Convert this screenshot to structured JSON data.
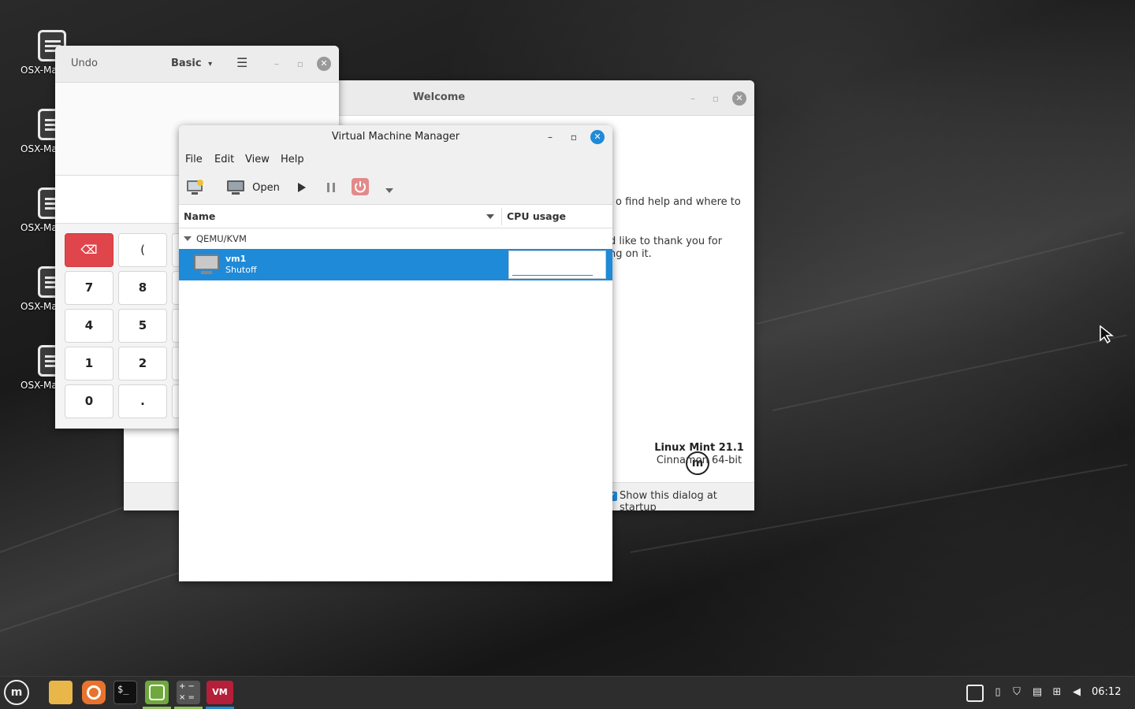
{
  "desktop": {
    "icons": [
      {
        "label": "OSX-Ma"
      },
      {
        "label": "OSX-Ma"
      },
      {
        "label": "OSX-Ma"
      },
      {
        "label": "OSX-Ma"
      },
      {
        "label": "OSX-Ma"
      }
    ]
  },
  "welcome": {
    "title": "Welcome",
    "text_line1": "o find help and where to",
    "text_line2": "d like to thank you for",
    "text_line3": "ng on it.",
    "product_name": "Linux Mint 21.1",
    "product_edition": "Cinnamon 64-bit",
    "startup_checkbox_label": "Show this dialog at startup",
    "startup_checkbox_checked": true
  },
  "calculator": {
    "undo_label": "Undo",
    "mode_label": "Basic",
    "keys": {
      "backspace": "⌫",
      "open_paren": "(",
      "seven": "7",
      "eight": "8",
      "four": "4",
      "five": "5",
      "one": "1",
      "two": "2",
      "zero": "0",
      "point": "."
    }
  },
  "vmm": {
    "title": "Virtual Machine Manager",
    "menu": {
      "file": "File",
      "edit": "Edit",
      "view": "View",
      "help": "Help"
    },
    "toolbar": {
      "open_label": "Open"
    },
    "columns": {
      "name": "Name",
      "cpu": "CPU usage"
    },
    "group": "QEMU/KVM",
    "vms": [
      {
        "name": "vm1",
        "status": "Shutoff"
      }
    ]
  },
  "taskbar": {
    "clock": "06:12"
  },
  "colors": {
    "selection": "#1f8ad8",
    "mint_green": "#8fc15c",
    "close_button": "#1f8ad8",
    "backspace_key": "#e0454c"
  }
}
